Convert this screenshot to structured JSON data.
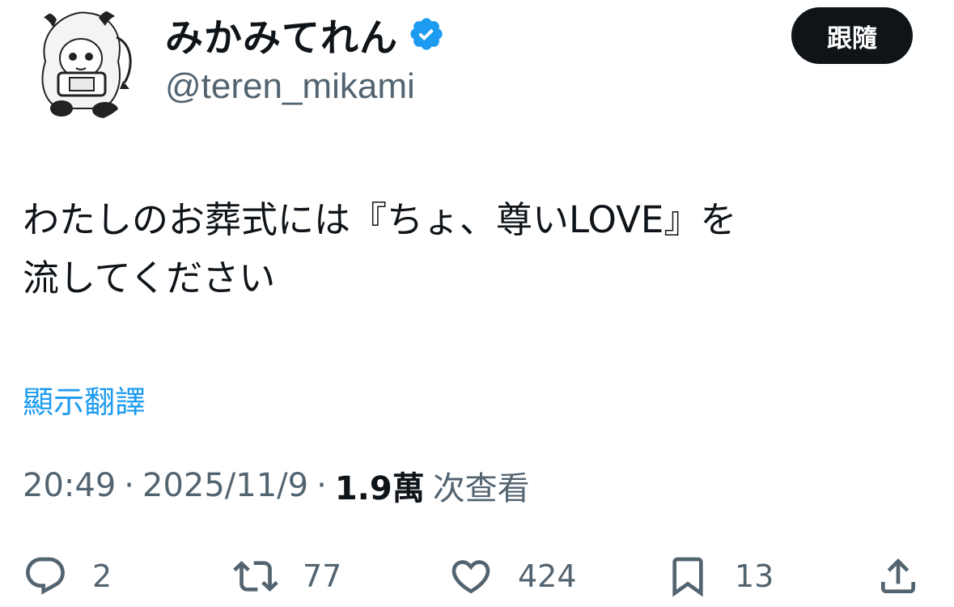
{
  "author": {
    "display_name": "みかみてれん",
    "handle": "@teren_mikami",
    "verified": true,
    "verified_color": "#1d9bf0"
  },
  "follow_button": {
    "label": "跟隨"
  },
  "tweet": {
    "text_lines": [
      "わたしのお葬式には『ちょ、尊いLOVE』を",
      "流してください"
    ],
    "translate_label": "顯示翻譯"
  },
  "meta": {
    "time": "20:49",
    "separator": "·",
    "date": "2025/11/9",
    "views_count": "1.9萬",
    "views_label": "次查看"
  },
  "actions": {
    "reply": {
      "icon": "reply-icon",
      "count": "2"
    },
    "repost": {
      "icon": "repost-icon",
      "count": "77"
    },
    "like": {
      "icon": "heart-icon",
      "count": "424"
    },
    "bookmark": {
      "icon": "bookmark-icon",
      "count": "13"
    },
    "share": {
      "icon": "share-icon"
    }
  },
  "colors": {
    "text_primary": "#0f1419",
    "text_secondary": "#536471",
    "link": "#1d9bf0",
    "button_bg": "#0f1419"
  }
}
